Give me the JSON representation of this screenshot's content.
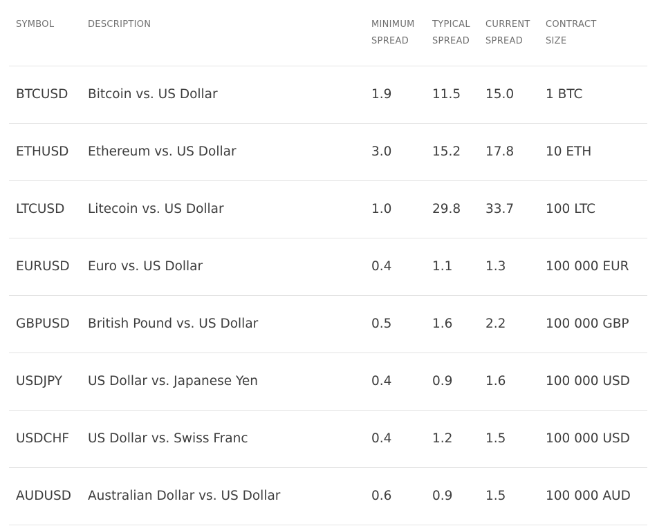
{
  "table": {
    "headers": {
      "symbol": [
        "SYMBOL"
      ],
      "description": [
        "DESCRIPTION"
      ],
      "minimum_spread": [
        "MINIMUM",
        "SPREAD"
      ],
      "typical_spread": [
        "TYPICAL",
        "SPREAD"
      ],
      "current_spread": [
        "CURRENT",
        "SPREAD"
      ],
      "contract_size": [
        "CONTRACT",
        "SIZE"
      ]
    },
    "rows": [
      {
        "symbol": "BTCUSD",
        "description": "Bitcoin vs. US Dollar",
        "minimum_spread": "1.9",
        "typical_spread": "11.5",
        "current_spread": "15.0",
        "contract_size": "1 BTC"
      },
      {
        "symbol": "ETHUSD",
        "description": "Ethereum vs. US Dollar",
        "minimum_spread": "3.0",
        "typical_spread": "15.2",
        "current_spread": "17.8",
        "contract_size": "10 ETH"
      },
      {
        "symbol": "LTCUSD",
        "description": "Litecoin vs. US Dollar",
        "minimum_spread": "1.0",
        "typical_spread": "29.8",
        "current_spread": "33.7",
        "contract_size": "100 LTC"
      },
      {
        "symbol": "EURUSD",
        "description": "Euro vs. US Dollar",
        "minimum_spread": "0.4",
        "typical_spread": "1.1",
        "current_spread": "1.3",
        "contract_size": "100 000 EUR"
      },
      {
        "symbol": "GBPUSD",
        "description": "British Pound vs. US Dollar",
        "minimum_spread": "0.5",
        "typical_spread": "1.6",
        "current_spread": "2.2",
        "contract_size": "100 000 GBP"
      },
      {
        "symbol": "USDJPY",
        "description": "US Dollar vs. Japanese Yen",
        "minimum_spread": "0.4",
        "typical_spread": "0.9",
        "current_spread": "1.6",
        "contract_size": "100 000 USD"
      },
      {
        "symbol": "USDCHF",
        "description": "US Dollar vs. Swiss Franc",
        "minimum_spread": "0.4",
        "typical_spread": "1.2",
        "current_spread": "1.5",
        "contract_size": "100 000 USD"
      },
      {
        "symbol": "AUDUSD",
        "description": "Australian Dollar vs. US Dollar",
        "minimum_spread": "0.6",
        "typical_spread": "0.9",
        "current_spread": "1.5",
        "contract_size": "100 000 AUD"
      }
    ]
  }
}
